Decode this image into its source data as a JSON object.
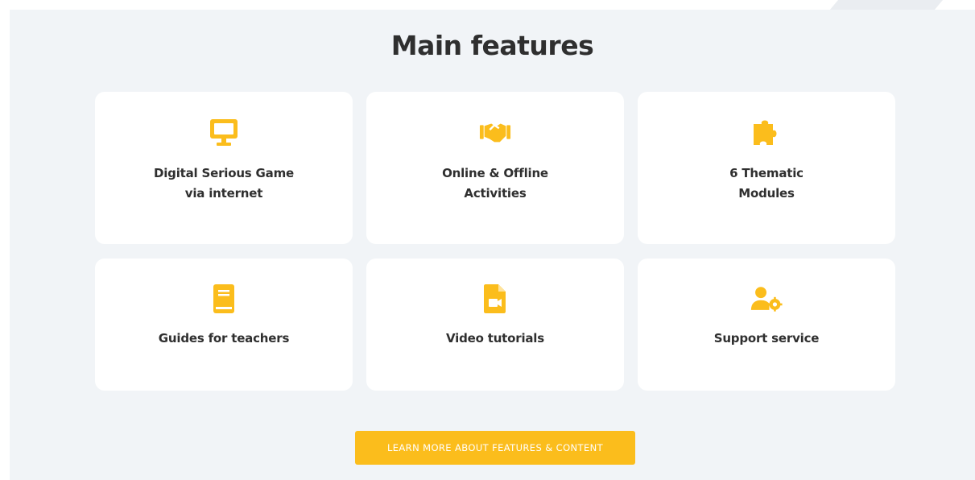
{
  "colors": {
    "accent": "#fbbd1c",
    "section_bg": "#f1f4f7",
    "card_bg": "#ffffff",
    "text": "#2f2f2f"
  },
  "section": {
    "title": "Main features"
  },
  "features": [
    {
      "icon": "monitor-icon",
      "line1": "Digital Serious Game",
      "line2": "via internet"
    },
    {
      "icon": "handshake-icon",
      "line1": "Online & Offline",
      "line2": "Activities"
    },
    {
      "icon": "puzzle-piece-icon",
      "line1": "6 Thematic",
      "line2": "Modules"
    },
    {
      "icon": "book-icon",
      "line1": "Guides for teachers",
      "line2": ""
    },
    {
      "icon": "video-file-icon",
      "line1": "Video tutorials",
      "line2": ""
    },
    {
      "icon": "user-cog-icon",
      "line1": "Support service",
      "line2": ""
    }
  ],
  "cta": {
    "label": "LEARN MORE ABOUT FEATURES & CONTENT"
  }
}
